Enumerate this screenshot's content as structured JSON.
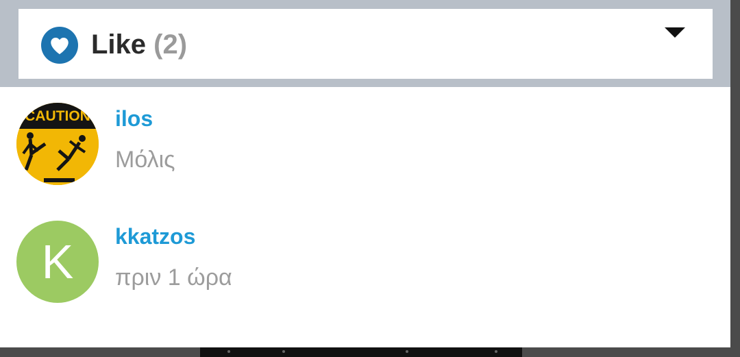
{
  "reaction": {
    "label": "Like",
    "count": "(2)",
    "icon": "heart-icon",
    "badge_color": "#1d74b0"
  },
  "users": [
    {
      "name": "ilos",
      "time": "Μόλις",
      "avatar": "caution-sign-photo",
      "avatar_text": "CAUTION"
    },
    {
      "name": "kkatzos",
      "time": "πριν 1 ώρα",
      "avatar_letter": "K",
      "avatar_color": "#9cca62"
    }
  ],
  "colors": {
    "username": "#1e9ad6",
    "timestamp": "#9c9c9c",
    "header_band": "#b8bfc8"
  }
}
